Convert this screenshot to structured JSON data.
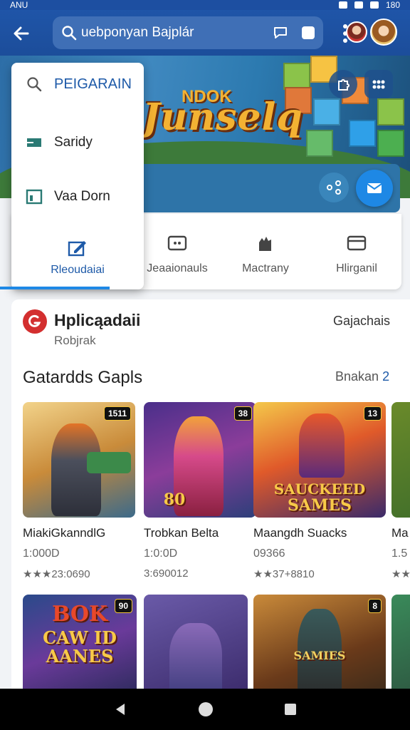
{
  "status_bar": {
    "time": "ANU",
    "right": "180"
  },
  "app_bar": {
    "search_text": "uebponyan Bajplár"
  },
  "hero": {
    "small_title": "NDOK",
    "big_title": "Junselq"
  },
  "dropdown": {
    "header": "PEIGARAIN",
    "items": [
      "Saridy",
      "Vaa Dorn"
    ],
    "active_tab": "Rleoudaiai"
  },
  "nav_tabs": [
    "Jeaaionauls",
    "Mactrany",
    "Hlirganil"
  ],
  "app_header": {
    "title": "Hplicąadaii",
    "subtitle": "Robjrak",
    "link": "Gajachais"
  },
  "section": {
    "title": "Gatardds Gapls",
    "more_label": "Bnakan",
    "more_count": "2"
  },
  "games": [
    {
      "name": "MiakiGkanndlG",
      "price": "1:000D",
      "rating": "★★★23:0690",
      "badge": "1511"
    },
    {
      "name": "Trobkan Belta",
      "price": "1:0:0D",
      "rating": "3:690012",
      "badge": "38"
    },
    {
      "name": "Maangdh Suacks",
      "price": "09366",
      "rating": "★★37+8810",
      "badge": "13"
    },
    {
      "name": "Ma",
      "price": "1.5",
      "rating": "★★",
      "badge": ""
    }
  ],
  "art_texts": {
    "game2_label": "80",
    "game3_line1": "SAUCKEED",
    "game3_line2": "SAMES",
    "row2_game1_line1": "BOK",
    "row2_game1_line2": "CAW ID",
    "row2_game1_line3": "AANES",
    "row2_game3_label": "SAMIES"
  },
  "row2_badges": [
    "90",
    "",
    "8"
  ],
  "colors": {
    "app_bar": "#1f55a8",
    "accent": "#1e5aa8",
    "fab": "#1e88e5",
    "logo_red": "#d32f2f"
  }
}
